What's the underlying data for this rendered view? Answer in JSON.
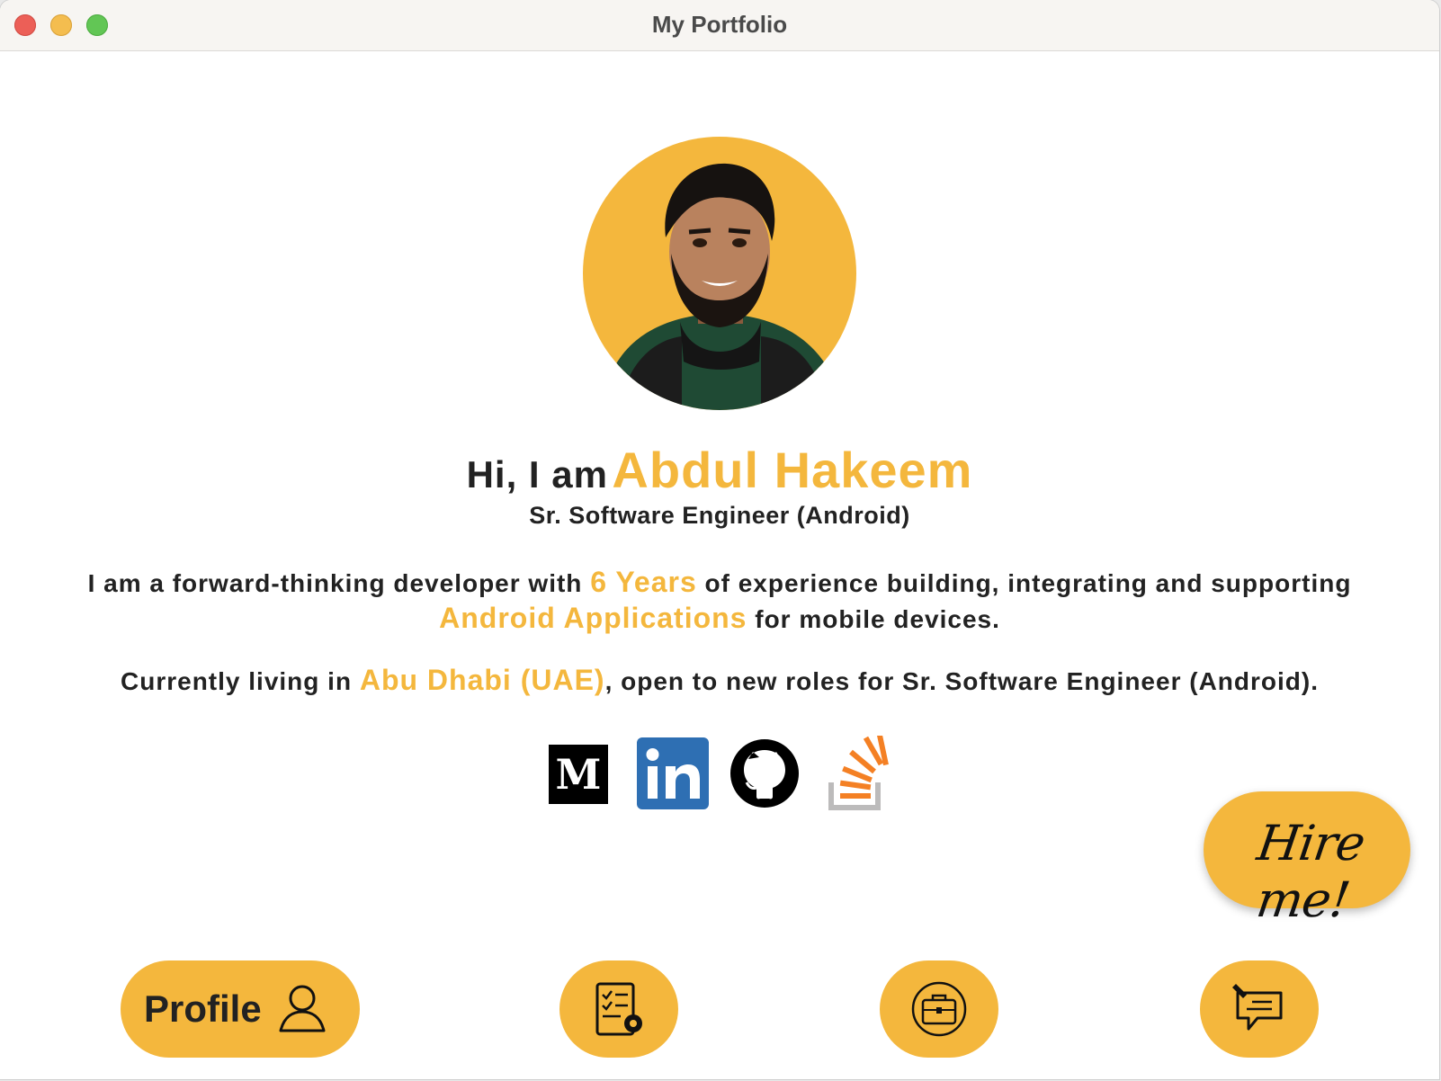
{
  "window": {
    "title": "My Portfolio"
  },
  "profile": {
    "greeting_prefix": "Hi, I am",
    "name": "Abdul Hakeem",
    "role": "Sr. Software Engineer (Android)",
    "avatar_alt": "avatar"
  },
  "intro": {
    "line1_pre": "I am a forward-thinking developer with",
    "line1_highlight": "6 Years",
    "line1_post": "of experience building, integrating and supporting",
    "line2_highlight": "Android Applications",
    "line2_post": "for mobile devices."
  },
  "location": {
    "pre": "Currently living in",
    "highlight": "Abu Dhabi (UAE)",
    "post": ", open to new roles for Sr. Software Engineer (Android)."
  },
  "social": [
    {
      "name": "medium-icon",
      "glyph": "M"
    },
    {
      "name": "linkedin-icon",
      "glyph": "in"
    },
    {
      "name": "github-icon"
    },
    {
      "name": "stackoverflow-icon"
    }
  ],
  "hire": {
    "label": "Hire me!"
  },
  "nav": {
    "profile_label": "Profile",
    "items": [
      "person-icon",
      "skills-icon",
      "briefcase-icon",
      "chat-icon"
    ]
  },
  "colors": {
    "accent": "#f4b73d",
    "text": "#222222",
    "linkedin": "#2e6fb3",
    "stackoverflow": "#f48024"
  }
}
